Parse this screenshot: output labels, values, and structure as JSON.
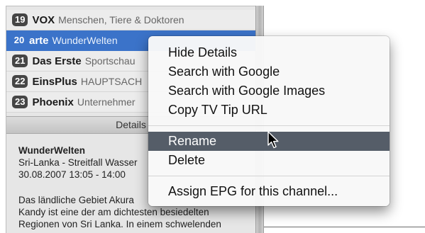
{
  "channels": [
    {
      "number": "19",
      "name": "VOX",
      "show": "Menschen, Tiere & Doktoren"
    },
    {
      "number": "20",
      "name": "arte",
      "show": "WunderWelten"
    },
    {
      "number": "21",
      "name": "Das Erste",
      "show": "Sportschau"
    },
    {
      "number": "22",
      "name": "EinsPlus",
      "show": "HAUPTSACH"
    },
    {
      "number": "23",
      "name": "Phoenix",
      "show": "Unternehmer"
    }
  ],
  "details": {
    "header": "Details",
    "title": "WunderWelten",
    "subtitle": "Sri-Lanka - Streitfall Wasser",
    "datetime": "30.08.2007 13:05 - 14:00",
    "description_lines": [
      "Das ländliche Gebiet Akura",
      "Kandy ist eine der am dichtesten besiedelten",
      "Regionen von Sri Lanka. In einem schwelenden"
    ]
  },
  "menu": {
    "items_group1": [
      "Hide Details",
      "Search with Google",
      "Search with Google Images",
      "Copy TV Tip URL"
    ],
    "items_group2": [
      "Rename",
      "Delete"
    ],
    "items_group3": [
      "Assign EPG for this channel..."
    ],
    "highlighted": "Rename"
  },
  "colors": {
    "selection": "#3b73c9",
    "menu_highlight": "#555d68",
    "badge": "#454545"
  },
  "icons": {
    "cursor": "arrow-cursor-icon"
  }
}
